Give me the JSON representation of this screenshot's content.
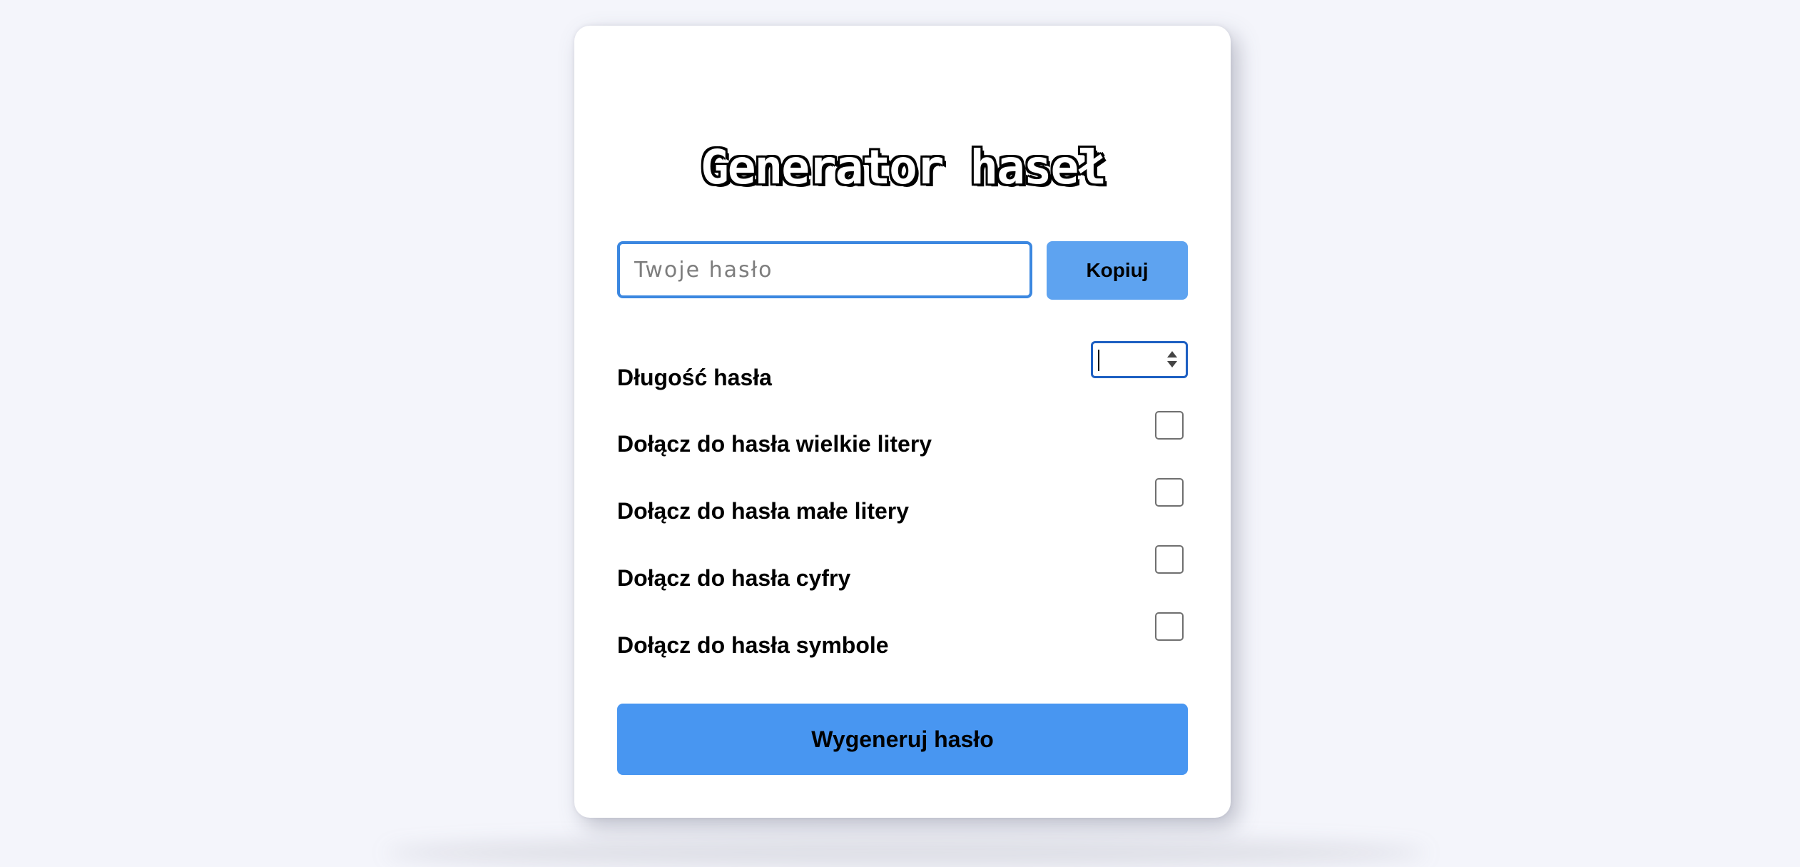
{
  "app": {
    "title": "Generator haseł"
  },
  "password": {
    "placeholder": "Twoje hasło",
    "value": "",
    "copy_label": "Kopiuj"
  },
  "options": {
    "length_label": "Długość hasła",
    "length_value": "",
    "uppercase_label": "Dołącz do hasła wielkie litery",
    "uppercase_checked": false,
    "lowercase_label": "Dołącz do hasła małe litery",
    "lowercase_checked": false,
    "numbers_label": "Dołącz do hasła cyfry",
    "numbers_checked": false,
    "symbols_label": "Dołącz do hasła symbole",
    "symbols_checked": false
  },
  "actions": {
    "generate_label": "Wygeneruj hasło"
  },
  "colors": {
    "page_background": "#f4f5fb",
    "card_background": "#ffffff",
    "copy_button": "#5ea3f0",
    "generate_button": "#4896f1",
    "input_border": "#3b87e0",
    "focus_border": "#1d5fc2"
  }
}
